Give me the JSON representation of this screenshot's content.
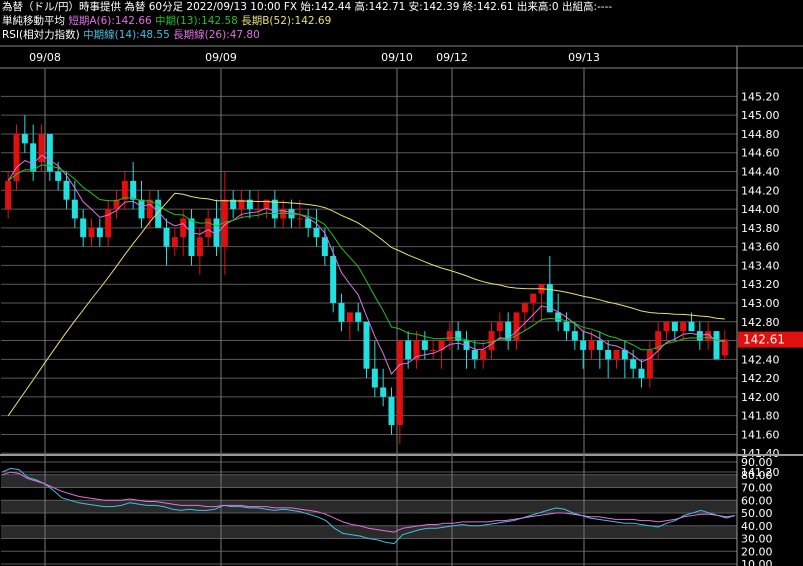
{
  "header": {
    "line1": "為替（ドル/円）時事提供 為替 60分足 2022/09/13 10:00 FX 始:142.44 高:142.71 安:142.39 終:142.61 出来高:0 出組高:----",
    "sma": {
      "title": "単純移動平均",
      "short": "短期A(6):142.66",
      "mid": "中期(13):142.58",
      "long": "長期B(52):142.69"
    },
    "rsi": {
      "title": "RSI(相対力指数)",
      "mid": "中期線(14):48.55",
      "long": "長期線(26):47.80"
    }
  },
  "colors": {
    "up": "#e01010",
    "down": "#20e0e0",
    "sma_short": "#e070e0",
    "sma_mid": "#20c020",
    "sma_long": "#e8e070",
    "rsi_mid": "#40c0e0",
    "rsi_long": "#e070e0",
    "price_tag_bg": "#e01010"
  },
  "chart_data": [
    {
      "type": "candlestick",
      "date_labels": [
        "09/08",
        "09/09",
        "09/10",
        "09/12",
        "09/13"
      ],
      "ylim": [
        141.2,
        145.3
      ],
      "y_ticks": [
        "145.20",
        "145.00",
        "144.80",
        "144.60",
        "144.40",
        "144.20",
        "144.00",
        "143.80",
        "143.60",
        "143.40",
        "143.20",
        "143.00",
        "142.80",
        "142.60",
        "142.40",
        "142.20",
        "142.00",
        "141.80",
        "141.60",
        "141.40",
        "141.20"
      ],
      "last_price": "142.61",
      "ohlc": [
        [
          144.0,
          144.4,
          143.9,
          144.3
        ],
        [
          144.3,
          144.9,
          144.2,
          144.8
        ],
        [
          144.8,
          145.0,
          144.6,
          144.7
        ],
        [
          144.7,
          144.9,
          144.3,
          144.4
        ],
        [
          144.5,
          144.9,
          144.4,
          144.8
        ],
        [
          144.8,
          144.8,
          144.3,
          144.4
        ],
        [
          144.4,
          144.5,
          144.2,
          144.3
        ],
        [
          144.3,
          144.4,
          144.0,
          144.1
        ],
        [
          144.1,
          144.3,
          143.8,
          143.9
        ],
        [
          143.9,
          144.0,
          143.6,
          143.7
        ],
        [
          143.7,
          143.9,
          143.6,
          143.8
        ],
        [
          143.8,
          143.9,
          143.6,
          143.7
        ],
        [
          143.7,
          144.1,
          143.6,
          144.0
        ],
        [
          144.0,
          144.2,
          143.9,
          144.1
        ],
        [
          144.1,
          144.4,
          144.0,
          144.3
        ],
        [
          144.3,
          144.5,
          144.0,
          144.1
        ],
        [
          144.1,
          144.3,
          143.8,
          143.9
        ],
        [
          143.9,
          144.2,
          143.8,
          144.1
        ],
        [
          144.1,
          144.2,
          143.8,
          143.8
        ],
        [
          143.8,
          143.9,
          143.4,
          143.6
        ],
        [
          143.6,
          143.8,
          143.5,
          143.7
        ],
        [
          143.7,
          144.0,
          143.5,
          143.9
        ],
        [
          143.9,
          144.0,
          143.4,
          143.5
        ],
        [
          143.5,
          143.8,
          143.3,
          143.7
        ],
        [
          143.7,
          144.0,
          143.6,
          143.9
        ],
        [
          143.9,
          144.1,
          143.5,
          143.6
        ],
        [
          143.6,
          144.4,
          143.3,
          144.1
        ],
        [
          144.1,
          144.2,
          143.9,
          144.0
        ],
        [
          144.0,
          144.2,
          143.9,
          144.1
        ],
        [
          144.1,
          144.2,
          143.9,
          144.0
        ],
        [
          144.0,
          144.2,
          143.9,
          144.0
        ],
        [
          144.0,
          144.1,
          143.9,
          144.1
        ],
        [
          144.1,
          144.2,
          143.8,
          143.9
        ],
        [
          143.9,
          144.1,
          143.8,
          144.0
        ],
        [
          144.0,
          144.1,
          143.8,
          143.9
        ],
        [
          143.9,
          144.1,
          143.8,
          143.9
        ],
        [
          143.9,
          144.0,
          143.7,
          143.8
        ],
        [
          143.8,
          144.0,
          143.6,
          143.7
        ],
        [
          143.7,
          143.8,
          143.4,
          143.5
        ],
        [
          143.5,
          143.6,
          142.9,
          143.0
        ],
        [
          143.0,
          143.1,
          142.7,
          142.8
        ],
        [
          142.8,
          142.9,
          142.6,
          142.9
        ],
        [
          142.9,
          143.0,
          142.7,
          142.8
        ],
        [
          142.8,
          142.8,
          142.2,
          142.3
        ],
        [
          142.3,
          142.6,
          142.0,
          142.1
        ],
        [
          142.1,
          142.3,
          141.9,
          142.0
        ],
        [
          142.0,
          142.1,
          141.6,
          141.7
        ],
        [
          141.7,
          142.6,
          141.5,
          142.6
        ],
        [
          142.6,
          142.7,
          142.3,
          142.4
        ],
        [
          142.4,
          142.7,
          142.3,
          142.6
        ],
        [
          142.6,
          142.7,
          142.4,
          142.5
        ],
        [
          142.5,
          142.6,
          142.4,
          142.5
        ],
        [
          142.5,
          142.6,
          142.3,
          142.6
        ],
        [
          142.6,
          142.8,
          142.5,
          142.7
        ],
        [
          142.7,
          142.8,
          142.5,
          142.6
        ],
        [
          142.6,
          142.7,
          142.3,
          142.5
        ],
        [
          142.5,
          142.6,
          142.3,
          142.4
        ],
        [
          142.4,
          142.6,
          142.3,
          142.5
        ],
        [
          142.5,
          142.8,
          142.4,
          142.7
        ],
        [
          142.7,
          142.9,
          142.6,
          142.8
        ],
        [
          142.8,
          142.9,
          142.5,
          142.6
        ],
        [
          142.6,
          142.9,
          142.5,
          142.9
        ],
        [
          142.9,
          143.0,
          142.7,
          143.0
        ],
        [
          143.0,
          143.1,
          142.8,
          143.1
        ],
        [
          143.1,
          143.2,
          142.8,
          143.2
        ],
        [
          143.2,
          143.5,
          142.9,
          142.9
        ],
        [
          142.9,
          143.1,
          142.7,
          142.8
        ],
        [
          142.8,
          142.9,
          142.6,
          142.7
        ],
        [
          142.7,
          142.8,
          142.5,
          142.6
        ],
        [
          142.6,
          142.7,
          142.3,
          142.5
        ],
        [
          142.5,
          142.7,
          142.4,
          142.6
        ],
        [
          142.6,
          142.7,
          142.3,
          142.5
        ],
        [
          142.5,
          142.6,
          142.2,
          142.4
        ],
        [
          142.4,
          142.5,
          142.3,
          142.5
        ],
        [
          142.5,
          142.6,
          142.2,
          142.4
        ],
        [
          142.4,
          142.5,
          142.2,
          142.3
        ],
        [
          142.3,
          142.4,
          142.1,
          142.2
        ],
        [
          142.2,
          142.6,
          142.1,
          142.5
        ],
        [
          142.5,
          142.8,
          142.4,
          142.7
        ],
        [
          142.7,
          142.8,
          142.6,
          142.8
        ],
        [
          142.8,
          142.8,
          142.6,
          142.7
        ],
        [
          142.7,
          142.8,
          142.6,
          142.8
        ],
        [
          142.8,
          142.9,
          142.7,
          142.7
        ],
        [
          142.7,
          142.8,
          142.5,
          142.6
        ],
        [
          142.6,
          142.8,
          142.5,
          142.7
        ],
        [
          142.7,
          142.7,
          142.4,
          142.4
        ],
        [
          142.44,
          142.71,
          142.39,
          142.61
        ]
      ]
    },
    {
      "type": "line",
      "ylim": [
        10,
        90
      ],
      "y_ticks": [
        "90.00",
        "80.00",
        "70.00",
        "60.00",
        "50.00",
        "40.00",
        "30.00",
        "20.00",
        "10.00"
      ],
      "series": [
        {
          "name": "中期線(14)",
          "values": [
            82,
            85,
            84,
            78,
            76,
            73,
            68,
            62,
            60,
            58,
            57,
            56,
            55,
            55,
            56,
            58,
            57,
            56,
            56,
            55,
            53,
            52,
            53,
            52,
            52,
            53,
            56,
            55,
            55,
            54,
            54,
            53,
            52,
            53,
            52,
            51,
            49,
            47,
            44,
            38,
            34,
            33,
            32,
            30,
            29,
            27,
            26,
            33,
            35,
            37,
            38,
            38,
            39,
            40,
            41,
            40,
            40,
            41,
            42,
            43,
            44,
            46,
            48,
            50,
            52,
            54,
            53,
            50,
            48,
            46,
            45,
            44,
            43,
            42,
            42,
            41,
            40,
            39,
            42,
            44,
            48,
            50,
            52,
            50,
            48,
            46,
            48
          ]
        },
        {
          "name": "長期線(26)",
          "values": [
            80,
            82,
            81,
            77,
            75,
            73,
            70,
            67,
            65,
            63,
            62,
            61,
            60,
            60,
            60,
            61,
            60,
            59,
            59,
            58,
            57,
            56,
            56,
            56,
            55,
            55,
            56,
            56,
            56,
            55,
            55,
            55,
            54,
            54,
            54,
            53,
            52,
            51,
            49,
            46,
            43,
            41,
            40,
            38,
            37,
            36,
            35,
            38,
            39,
            40,
            41,
            41,
            42,
            42,
            43,
            43,
            43,
            43,
            44,
            44,
            45,
            46,
            47,
            48,
            49,
            50,
            50,
            49,
            48,
            47,
            47,
            46,
            45,
            45,
            45,
            44,
            44,
            43,
            44,
            45,
            47,
            48,
            49,
            49,
            48,
            47,
            48
          ]
        }
      ]
    }
  ]
}
